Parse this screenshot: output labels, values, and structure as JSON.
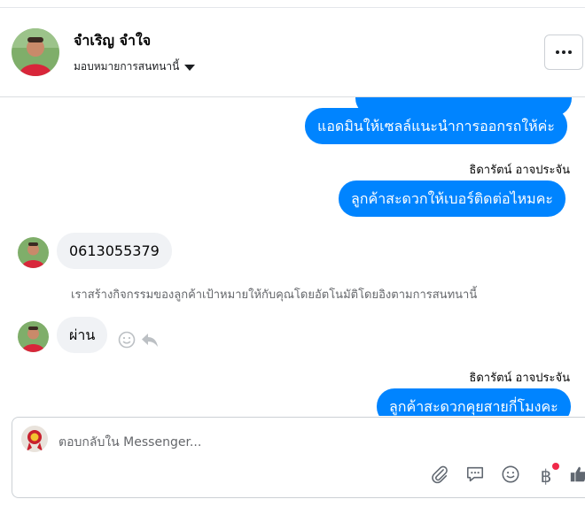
{
  "header": {
    "name": "จำเริญ จำใจ",
    "assign_label": "มอบหมายการสนทนานี้",
    "more_icon": "ellipsis-icon"
  },
  "messages": {
    "out_1": "แอดมินให้เซลล์แนะนำการออกรถให้ค่ะ",
    "sender_1": "ธิดารัตน์ อาจประจัน",
    "out_2": "ลูกค้าสะดวกให้เบอร์ติดต่อไหมคะ",
    "in_1": "0613055379",
    "system_note": "เราสร้างกิจกรรมของลูกค้าเป้าหมายให้กับคุณโดยอัตโนมัติโดยอิงตามการสนทนานี้",
    "in_2": "ผ่าน",
    "sender_2": "ธิดารัตน์ อาจประจัน",
    "out_3": "ลูกค้าสะดวกคุยสายกี่โมงคะ"
  },
  "composer": {
    "placeholder": "ตอบกลับใน Messenger...",
    "tools": [
      "paperclip-icon",
      "saved-reply-icon",
      "emoji-icon",
      "baht-icon",
      "thumbs-up-icon"
    ],
    "baht_symbol": "฿"
  },
  "colors": {
    "outgoing_bubble": "#0084ff",
    "incoming_bubble": "#f0f2f5",
    "notification_dot": "#f02849"
  }
}
